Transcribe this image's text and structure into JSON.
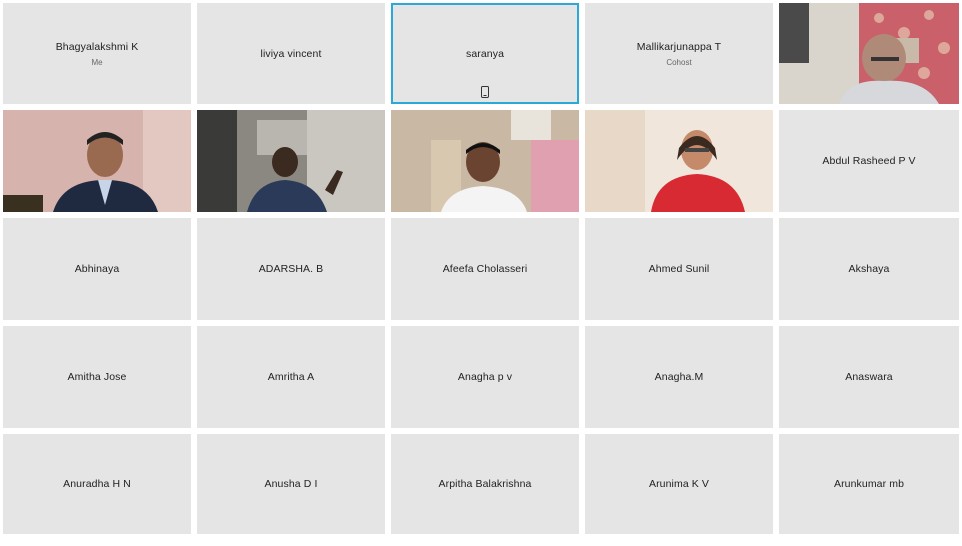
{
  "participants": [
    {
      "name": "Bhagyalakshmi K",
      "role": "Me",
      "video": false
    },
    {
      "name": "liviya vincent",
      "video": false
    },
    {
      "name": "saranya",
      "video": false,
      "active": true,
      "icon": "mobile-device-icon"
    },
    {
      "name": "Mallikarjunappa T",
      "role": "Cohost",
      "video": false
    },
    {
      "video": true,
      "scene": "elderly-man-red-curtain"
    },
    {
      "video": true,
      "scene": "man-suit-pink-wall"
    },
    {
      "video": true,
      "scene": "man-dark-room-gesturing"
    },
    {
      "video": true,
      "scene": "man-white-shirt-office"
    },
    {
      "video": true,
      "scene": "woman-red-top"
    },
    {
      "name": "Abdul Rasheed P V",
      "video": false
    },
    {
      "name": "Abhinaya",
      "video": false
    },
    {
      "name": "ADARSHA. B",
      "video": false
    },
    {
      "name": "Afeefa Cholasseri",
      "video": false
    },
    {
      "name": "Ahmed Sunil",
      "video": false
    },
    {
      "name": "Akshaya",
      "video": false
    },
    {
      "name": "Amitha Jose",
      "video": false
    },
    {
      "name": "Amritha A",
      "video": false
    },
    {
      "name": "Anagha p v",
      "video": false
    },
    {
      "name": "Anagha.M",
      "video": false
    },
    {
      "name": "Anaswara",
      "video": false
    },
    {
      "name": "Anuradha H N",
      "video": false
    },
    {
      "name": "Anusha D I",
      "video": false
    },
    {
      "name": "Arpitha Balakrishna",
      "video": false
    },
    {
      "name": "Arunima K V",
      "video": false
    },
    {
      "name": "Arunkumar mb",
      "video": false
    }
  ],
  "colors": {
    "active_border": "#2aa8d8",
    "tile_bg": "#e5e5e5"
  }
}
